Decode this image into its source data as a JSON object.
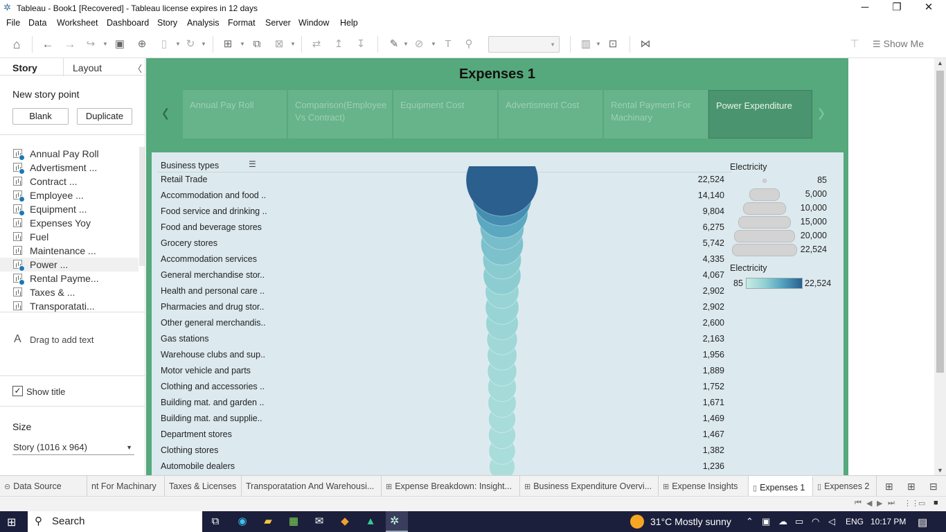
{
  "window": {
    "title": "Tableau - Book1 [Recovered] - Tableau license expires in 12 days",
    "minimize": "─",
    "maximize": "❐",
    "close": "✕"
  },
  "menu": [
    "File",
    "Data",
    "Worksheet",
    "Dashboard",
    "Story",
    "Analysis",
    "Format",
    "Server",
    "Window",
    "Help"
  ],
  "toolbar": {
    "show_me": "Show Me"
  },
  "left_pane": {
    "tab_story": "Story",
    "tab_layout": "Layout",
    "new_story_point": "New story point",
    "blank_button": "Blank",
    "duplicate_button": "Duplicate",
    "sheets": [
      {
        "label": "Annual Pay Roll",
        "checked": true
      },
      {
        "label": "Advertisment ...",
        "checked": true
      },
      {
        "label": "Contract ...",
        "checked": false
      },
      {
        "label": "Employee ...",
        "checked": true
      },
      {
        "label": "Equipment ...",
        "checked": true
      },
      {
        "label": "Expenses Yoy",
        "checked": false
      },
      {
        "label": "Fuel",
        "checked": false
      },
      {
        "label": "Maintenance ...",
        "checked": false
      },
      {
        "label": "Power ...",
        "checked": true
      },
      {
        "label": "Rental Payme...",
        "checked": true
      },
      {
        "label": "Taxes & ...",
        "checked": false
      },
      {
        "label": "Transporatati...",
        "checked": false
      }
    ],
    "drag_text": "Drag to add text",
    "show_title": "Show title",
    "show_title_checked": true,
    "size_label": "Size",
    "size_value": "Story (1016 x 964)"
  },
  "story": {
    "title": "Expenses 1",
    "points": [
      "Annual Pay Roll",
      "Comparison(Employee Vs Contract)",
      "Equipment Cost",
      "Advertisment Cost",
      "Rental Payment For Machinary",
      "Power  Expenditure"
    ],
    "active_point_index": 5
  },
  "viz": {
    "column_header": "Business types",
    "size_legend_title": "Electricity",
    "size_legend_values": [
      "85",
      "5,000",
      "10,000",
      "15,000",
      "20,000",
      "22,524"
    ],
    "color_legend_title": "Electricity",
    "color_legend_min": "85",
    "color_legend_max": "22,524",
    "color_ramp": [
      "#c6ece5",
      "#91d0d2",
      "#4f9fbd",
      "#2a5f8e"
    ]
  },
  "chart_data": {
    "type": "table",
    "columns": [
      "Business types",
      "Electricity"
    ],
    "rows": [
      {
        "label": "Retail Trade",
        "display": "22,524",
        "value": 22524
      },
      {
        "label": "Accommodation and food ..",
        "display": "14,140",
        "value": 14140
      },
      {
        "label": "Food service and drinking ..",
        "display": "9,804",
        "value": 9804
      },
      {
        "label": "Food and beverage stores",
        "display": "6,275",
        "value": 6275
      },
      {
        "label": "Grocery stores",
        "display": "5,742",
        "value": 5742
      },
      {
        "label": "Accommodation services",
        "display": "4,335",
        "value": 4335
      },
      {
        "label": "General merchandise stor..",
        "display": "4,067",
        "value": 4067
      },
      {
        "label": "Health and personal care ..",
        "display": "2,902",
        "value": 2902
      },
      {
        "label": "Pharmacies and drug stor..",
        "display": "2,902",
        "value": 2902
      },
      {
        "label": "Other general merchandis..",
        "display": "2,600",
        "value": 2600
      },
      {
        "label": "Gas stations",
        "display": "2,163",
        "value": 2163
      },
      {
        "label": "Warehouse clubs and sup..",
        "display": "1,956",
        "value": 1956
      },
      {
        "label": "Motor vehicle and parts",
        "display": "1,889",
        "value": 1889
      },
      {
        "label": "Clothing and accessories ..",
        "display": "1,752",
        "value": 1752
      },
      {
        "label": "Building mat. and garden ..",
        "display": "1,671",
        "value": 1671
      },
      {
        "label": "Building mat. and supplie..",
        "display": "1,469",
        "value": 1469
      },
      {
        "label": "Department stores",
        "display": "1,467",
        "value": 1467
      },
      {
        "label": "Clothing stores",
        "display": "1,382",
        "value": 1382
      },
      {
        "label": "Automobile dealers",
        "display": "1,236",
        "value": 1236
      }
    ],
    "size_range": [
      85,
      22524
    ]
  },
  "bottom_tabs": [
    {
      "label": "Data Source",
      "icon": "database-icon",
      "active": false
    },
    {
      "label": "nt For Machinary",
      "icon": "",
      "active": false
    },
    {
      "label": "Taxes & Licenses",
      "icon": "",
      "active": false
    },
    {
      "label": "Transporatation And Warehousi...",
      "icon": "",
      "active": false
    },
    {
      "label": "Expense Breakdown: Insight...",
      "icon": "dashboard-icon",
      "active": false
    },
    {
      "label": "Business Expenditure Overvi...",
      "icon": "dashboard-icon",
      "active": false
    },
    {
      "label": "Expense Insights",
      "icon": "dashboard-icon",
      "active": false
    },
    {
      "label": "Expenses 1",
      "icon": "story-icon",
      "active": true
    },
    {
      "label": "Expenses 2",
      "icon": "story-icon",
      "active": false
    }
  ],
  "taskbar": {
    "search": "Search",
    "weather": "31°C  Mostly sunny",
    "language": "ENG",
    "time": "10:17 PM"
  }
}
